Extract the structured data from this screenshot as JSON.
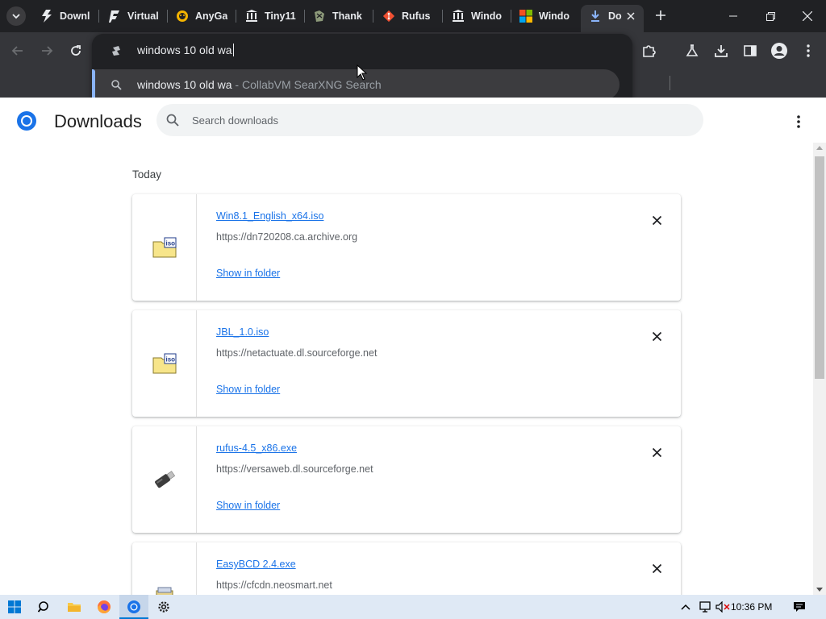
{
  "tabs": [
    {
      "title": "Downl",
      "icon": "flash-icon"
    },
    {
      "title": "Virtual",
      "icon": "flash-icon"
    },
    {
      "title": "AnyGa",
      "icon": "anygame-icon"
    },
    {
      "title": "Tiny11",
      "icon": "archive-icon"
    },
    {
      "title": "Thank",
      "icon": "puzzle-icon"
    },
    {
      "title": "Rufus",
      "icon": "git-icon"
    },
    {
      "title": "Windo",
      "icon": "archive-icon"
    },
    {
      "title": "Windo",
      "icon": "windows-logo-icon"
    },
    {
      "title": "Do",
      "icon": "download-icon",
      "active": true
    }
  ],
  "omnibox": {
    "input_text": "windows 10 old wa",
    "suggestion_query": "windows 10 old wa",
    "suggestion_source": " - CollabVM SearXNG Search"
  },
  "page": {
    "title": "Downloads",
    "search_placeholder": "Search downloads",
    "date_label": "Today"
  },
  "downloads": [
    {
      "filename": "Win8.1_English_x64.iso",
      "url": "https://dn720208.ca.archive.org",
      "action": "Show in folder",
      "icon": "iso-file-icon"
    },
    {
      "filename": "JBL_1.0.iso",
      "url": "https://netactuate.dl.sourceforge.net",
      "action": "Show in folder",
      "icon": "iso-file-icon"
    },
    {
      "filename": "rufus-4.5_x86.exe",
      "url": "https://versaweb.dl.sourceforge.net",
      "action": "Show in folder",
      "icon": "usb-drive-icon"
    },
    {
      "filename": "EasyBCD 2.4.exe",
      "url": "https://cfcdn.neosmart.net",
      "action": "",
      "icon": "installer-icon"
    }
  ],
  "taskbar": {
    "clock": "10:36 PM"
  },
  "colors": {
    "tabstrip": "#202124",
    "toolbar": "#35363a",
    "link": "#1a73e8",
    "suggest_accent": "#8ab4f8",
    "taskbar": "#dfe9f5"
  }
}
